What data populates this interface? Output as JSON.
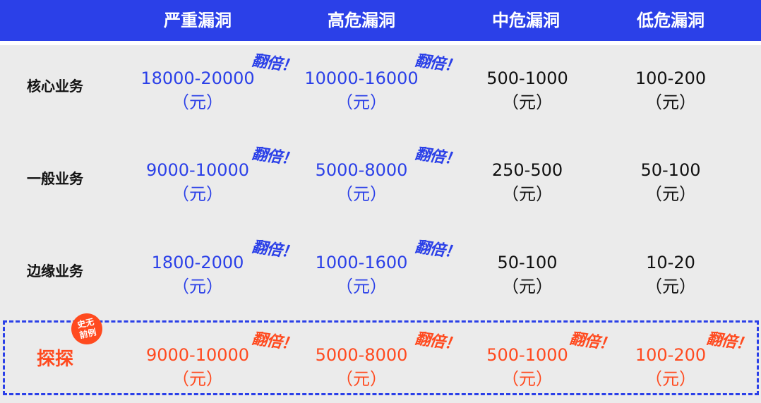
{
  "header": {
    "columns": [
      "严重漏洞",
      "高危漏洞",
      "中危漏洞",
      "低危漏洞"
    ]
  },
  "double_label": "翻倍！",
  "unit": "（元）",
  "rows": [
    {
      "label": "核心业务",
      "values": [
        "18000-20000",
        "10000-16000",
        "500-1000",
        "100-200"
      ]
    },
    {
      "label": "一般业务",
      "values": [
        "9000-10000",
        "5000-8000",
        "250-500",
        "50-100"
      ]
    },
    {
      "label": "边缘业务",
      "values": [
        "1800-2000",
        "1000-1600",
        "50-100",
        "10-20"
      ]
    }
  ],
  "special_row": {
    "label": "探探",
    "badge": [
      "史无",
      "前例"
    ],
    "values": [
      "9000-10000",
      "5000-8000",
      "500-1000",
      "100-200"
    ]
  },
  "colors": {
    "accent_blue": "#2b40e8",
    "accent_red": "#ff4a1f",
    "panel_bg": "#ebebeb"
  }
}
